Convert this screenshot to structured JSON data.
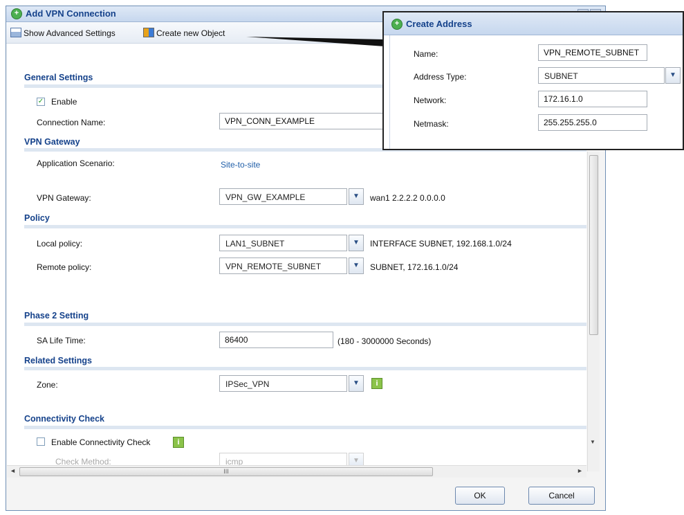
{
  "window": {
    "title": "Add VPN Connection",
    "controls": [
      "?",
      "X"
    ]
  },
  "toolbar": {
    "advanced_label": "Show Advanced Settings",
    "create_label": "Create new Object"
  },
  "general": {
    "heading": "General Settings",
    "enable_label": "Enable",
    "enable_checked": true,
    "conn_name_label": "Connection Name:",
    "conn_name_value": "VPN_CONN_EXAMPLE"
  },
  "gateway": {
    "heading": "VPN Gateway",
    "scenario_label": "Application Scenario:",
    "scenario_value": "Site-to-site",
    "gw_label": "VPN Gateway:",
    "gw_value": "VPN_GW_EXAMPLE",
    "gw_info": "wan1 2.2.2.2 0.0.0.0"
  },
  "policy": {
    "heading": "Policy",
    "local_label": "Local policy:",
    "local_value": "LAN1_SUBNET",
    "local_info": "INTERFACE SUBNET, 192.168.1.0/24",
    "remote_label": "Remote policy:",
    "remote_value": "VPN_REMOTE_SUBNET",
    "remote_info": "SUBNET, 172.16.1.0/24"
  },
  "phase2": {
    "heading": "Phase 2 Setting",
    "sa_label": "SA Life Time:",
    "sa_value": "86400",
    "sa_hint": "(180 - 3000000 Seconds)"
  },
  "related": {
    "heading": "Related Settings",
    "zone_label": "Zone:",
    "zone_value": "IPSec_VPN"
  },
  "connectivity": {
    "heading": "Connectivity Check",
    "enable_label": "Enable Connectivity Check",
    "enable_checked": false,
    "method_label": "Check Method:",
    "method_value": "icmp"
  },
  "scrollbar": {
    "h_grip": "III"
  },
  "buttons": {
    "ok": "OK",
    "cancel": "Cancel"
  },
  "popup": {
    "title": "Create Address",
    "name_label": "Name:",
    "name_value": "VPN_REMOTE_SUBNET",
    "type_label": "Address Type:",
    "type_value": "SUBNET",
    "network_label": "Network:",
    "network_value": "172.16.1.0",
    "netmask_label": "Netmask:",
    "netmask_value": "255.255.255.0"
  },
  "icons": {
    "add": "+",
    "check": "✓",
    "info": "i",
    "dropdown": "▼",
    "scroll_up": "▲",
    "scroll_down": "▼",
    "scroll_left": "◄",
    "scroll_right": "►"
  },
  "colors": {
    "heading": "#15428b",
    "link": "#1f5ea8",
    "info_icon": "#8bc34a",
    "add_icon": "#4caf50"
  }
}
